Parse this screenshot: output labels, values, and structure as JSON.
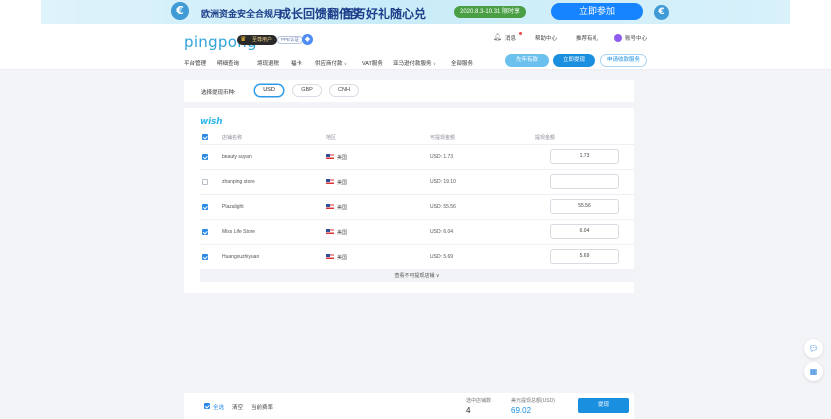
{
  "banner": {
    "euro_symbol": "€",
    "title_left": "欧洲资金安全合规月",
    "headline_1": "成长回馈翻倍奖",
    "headline_2": "百万好礼随心兑",
    "date_tag": "2020.8.3-10.31 限时享",
    "cta": "立即参加"
  },
  "header": {
    "logo": "pingpong",
    "vip_label": "至尊用户",
    "cert_label": "PPE认证",
    "top_links": {
      "messages": "消息",
      "help": "帮助中心",
      "recommend": "推荐有礼",
      "account": "账号中心"
    },
    "nav": [
      {
        "label": "平台管理",
        "caret": false
      },
      {
        "label": "明细查询",
        "caret": false
      },
      {
        "label": "境现退税",
        "caret": false
      },
      {
        "label": "福卡",
        "caret": false
      },
      {
        "label": "供应商付款",
        "caret": true
      },
      {
        "label": "VAT服务",
        "caret": false
      },
      {
        "label": "亚马逊付款服务",
        "caret": true
      },
      {
        "label": "全部服务",
        "caret": false
      }
    ],
    "pill_buttons": {
      "prepay": "先年有款",
      "withdraw": "立即提现",
      "apply_account": "申请收款服务"
    }
  },
  "currency": {
    "label": "选择提现币种:",
    "options": [
      "USD",
      "GBP",
      "CNH"
    ],
    "selected": "USD"
  },
  "store_table": {
    "platform_logo": "wish",
    "columns": {
      "name": "店铺名称",
      "region": "地区",
      "available": "可提现金额",
      "withdraw": "提现金额"
    },
    "rows": [
      {
        "checked": true,
        "name": "beauty suyan",
        "region": "美国",
        "available": "USD: 1.73",
        "withdraw": "1.73"
      },
      {
        "checked": false,
        "name": "zhanping store",
        "region": "美国",
        "available": "USD: 19.10",
        "withdraw": ""
      },
      {
        "checked": true,
        "name": "Plazalight",
        "region": "美国",
        "available": "USD: 55.56",
        "withdraw": "55.56"
      },
      {
        "checked": true,
        "name": "Miss Life Store",
        "region": "美国",
        "available": "USD: 6.04",
        "withdraw": "6.04"
      },
      {
        "checked": true,
        "name": "Huangxuzhiyuan",
        "region": "美国",
        "available": "USD: 5.69",
        "withdraw": "5.69"
      }
    ],
    "more_link": "查看不可提现店铺"
  },
  "floating": {
    "chat_icon": "chat-icon",
    "qr_icon": "qrcode-icon"
  },
  "bottom_bar": {
    "select_all": "全选",
    "clear": "清空",
    "hint": "当前费率",
    "selected_count_label": "选中店铺数",
    "selected_count": "4",
    "total_label": "美元提现总额(USD)",
    "total_value": "69.02",
    "submit": "提现"
  }
}
